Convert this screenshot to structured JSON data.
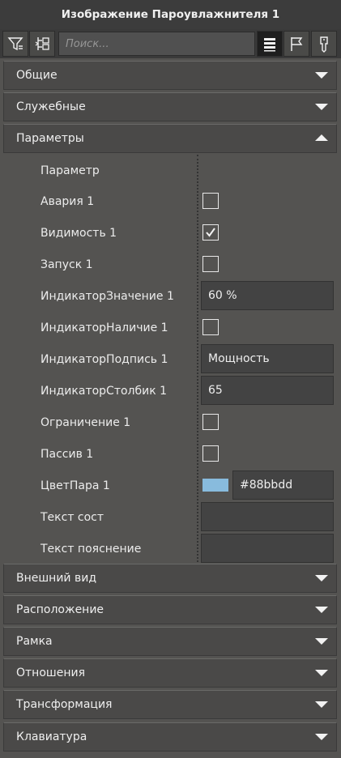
{
  "window": {
    "title": "Изображение Пароувлажнителя 1"
  },
  "toolbar": {
    "filter_icon": "filter-icon",
    "collapse_icon": "collapse-tree-icon",
    "search_placeholder": "Поиск...",
    "list_icon": "list-view-icon",
    "flag_icon": "flag-icon",
    "pin_icon": "pin-icon"
  },
  "sections_top": [
    {
      "label": "Общие",
      "expanded": false
    },
    {
      "label": "Служебные",
      "expanded": false
    },
    {
      "label": "Параметры",
      "expanded": true
    }
  ],
  "params": {
    "header": "Параметр",
    "rows": [
      {
        "label": "Авария 1",
        "type": "checkbox",
        "checked": false
      },
      {
        "label": "Видимость 1",
        "type": "checkbox",
        "checked": true
      },
      {
        "label": "Запуск 1",
        "type": "checkbox",
        "checked": false
      },
      {
        "label": "ИндикаторЗначение 1",
        "type": "text",
        "value": "60 %"
      },
      {
        "label": "ИндикаторНаличие 1",
        "type": "checkbox",
        "checked": false
      },
      {
        "label": "ИндикаторПодпись 1",
        "type": "text",
        "value": "Мощность"
      },
      {
        "label": "ИндикаторСтолбик 1",
        "type": "text",
        "value": "65"
      },
      {
        "label": "Ограничение 1",
        "type": "checkbox",
        "checked": false
      },
      {
        "label": "Пассив 1",
        "type": "checkbox",
        "checked": false
      },
      {
        "label": "ЦветПара 1",
        "type": "color",
        "value": "#88bbdd"
      },
      {
        "label": "Текст сост",
        "type": "text",
        "value": ""
      },
      {
        "label": "Текст пояснение",
        "type": "text",
        "value": ""
      }
    ]
  },
  "sections_bottom": [
    {
      "label": "Внешний вид",
      "expanded": false
    },
    {
      "label": "Расположение",
      "expanded": false
    },
    {
      "label": "Рамка",
      "expanded": false
    },
    {
      "label": "Отношения",
      "expanded": false
    },
    {
      "label": "Трансформация",
      "expanded": false
    },
    {
      "label": "Клавиатура",
      "expanded": false
    }
  ]
}
